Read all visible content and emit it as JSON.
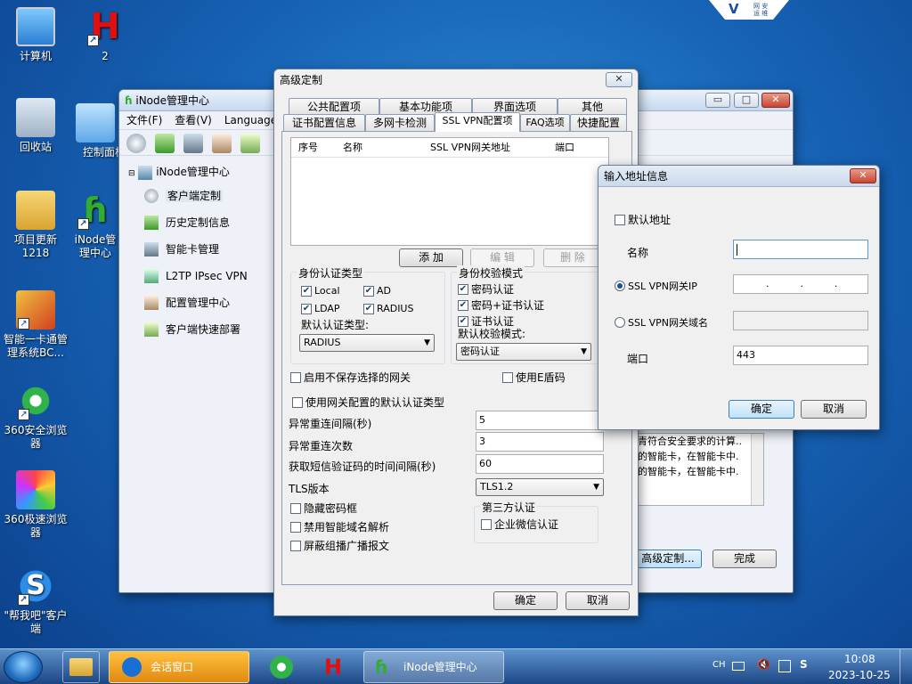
{
  "desktop": {
    "icons": [
      {
        "label": "计算机"
      },
      {
        "label": "2"
      },
      {
        "label": "回收站"
      },
      {
        "label": "控制面板"
      },
      {
        "label": "项目更新\n1218"
      },
      {
        "label": "iNode管理中心"
      },
      {
        "label": "智能一卡通管理系统BC..."
      },
      {
        "label": "360安全浏览器"
      },
      {
        "label": "360极速浏览器"
      },
      {
        "label": "\"帮我吧\"客户端"
      }
    ],
    "badge_text": "网 安\n运 维"
  },
  "inode": {
    "title": "iNode管理中心",
    "menu": [
      "文件(F)",
      "查看(V)",
      "Language"
    ],
    "tree_root": "iNode管理中心",
    "tree_items": [
      "客户端定制",
      "历史定制信息",
      "智能卡管理",
      "L2TP IPsec VPN",
      "配置管理中心",
      "客户端快速部署"
    ],
    "list_lines": [
      "青符合安全要求的计算..",
      "的智能卡，在智能卡中.",
      "的智能卡，在智能卡中."
    ],
    "btn_advanced": "高级定制...",
    "btn_finish": "完成"
  },
  "adv": {
    "title": "高级定制",
    "tabs_row1": [
      "公共配置项",
      "基本功能项",
      "界面选项",
      "其他"
    ],
    "tabs_row2": [
      "证书配置信息",
      "多网卡检测",
      "SSL VPN配置项",
      "FAQ选项",
      "快捷配置"
    ],
    "table_headers": [
      "序号",
      "名称",
      "SSL VPN网关地址",
      "端口"
    ],
    "btn_add": "添 加",
    "btn_edit": "编 辑",
    "btn_delete": "删 除",
    "auth_type_title": "身份认证类型",
    "auth_local": "Local",
    "auth_ad": "AD",
    "auth_ldap": "LDAP",
    "auth_radius": "RADIUS",
    "default_auth_label": "默认认证类型:",
    "default_auth_value": "RADIUS",
    "verify_title": "身份校验模式",
    "verify_pwd": "密码认证",
    "verify_pwd_cert": "密码+证书认证",
    "verify_cert": "证书认证",
    "default_verify_label": "默认校验模式:",
    "default_verify_value": "密码认证",
    "no_save_gateway": "启用不保存选择的网关",
    "use_e_code": "使用E盾码",
    "use_gateway_default": "使用网关配置的默认认证类型",
    "reconnect_interval_label": "异常重连间隔(秒)",
    "reconnect_interval_value": "5",
    "reconnect_count_label": "异常重连次数",
    "reconnect_count_value": "3",
    "sms_interval_label": "获取短信验证码的时间间隔(秒)",
    "sms_interval_value": "60",
    "tls_label": "TLS版本",
    "tls_value": "TLS1.2",
    "hide_pwd": "隐藏密码框",
    "disable_smart_dns": "禁用智能域名解析",
    "block_multicast": "屏蔽组播广播报文",
    "third_party_title": "第三方认证",
    "wechat_auth": "企业微信认证",
    "btn_ok": "确定",
    "btn_cancel": "取消"
  },
  "addr": {
    "title": "输入地址信息",
    "default_addr": "默认地址",
    "name_label": "名称",
    "name_value": "",
    "ip_label": "SSL VPN网关IP",
    "ip_value": ".          .          .",
    "domain_label": "SSL VPN网关域名",
    "port_label": "端口",
    "port_value": "443",
    "btn_ok": "确定",
    "btn_cancel": "取消"
  },
  "taskbar": {
    "task_chat": "会话窗口",
    "task_inode": "iNode管理中心",
    "lang": "CH",
    "time": "10:08",
    "date": "2023-10-25"
  }
}
